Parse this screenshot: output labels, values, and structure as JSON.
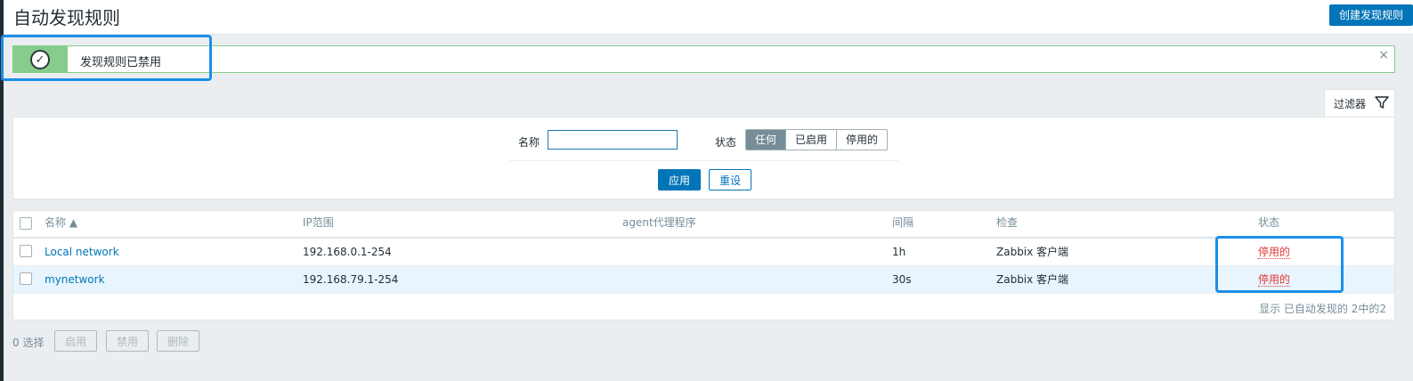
{
  "page": {
    "title": "自动发现规则",
    "create_button": "创建发现规则"
  },
  "message": {
    "text": "发现规则已禁用",
    "close_glyph": "×",
    "icon": "check-circle-icon"
  },
  "filter": {
    "tab_label": "过滤器",
    "name_label": "名称",
    "name_value": "",
    "status_label": "状态",
    "status_options": [
      "任何",
      "已启用",
      "停用的"
    ],
    "status_selected": "任何",
    "apply_label": "应用",
    "reset_label": "重设"
  },
  "table": {
    "columns": [
      "名称 ▲",
      "IP范围",
      "agent代理程序",
      "间隔",
      "检查",
      "状态"
    ],
    "rows": [
      {
        "name": "Local network",
        "ip_range": "192.168.0.1-254",
        "proxy": "",
        "interval": "1h",
        "checks": "Zabbix 客户端",
        "status": "停用的"
      },
      {
        "name": "mynetwork",
        "ip_range": "192.168.79.1-254",
        "proxy": "",
        "interval": "30s",
        "checks": "Zabbix 客户端",
        "status": "停用的"
      }
    ],
    "footer": "显示 已自动发现的 2中的2"
  },
  "actions": {
    "selected_count": "0 选择",
    "enable_label": "启用",
    "disable_label": "禁用",
    "delete_label": "删除"
  },
  "colors": {
    "accent": "#0275b8",
    "success": "#86cc8c",
    "disabled_status": "#e33734",
    "highlight": "#1b8fe8"
  }
}
